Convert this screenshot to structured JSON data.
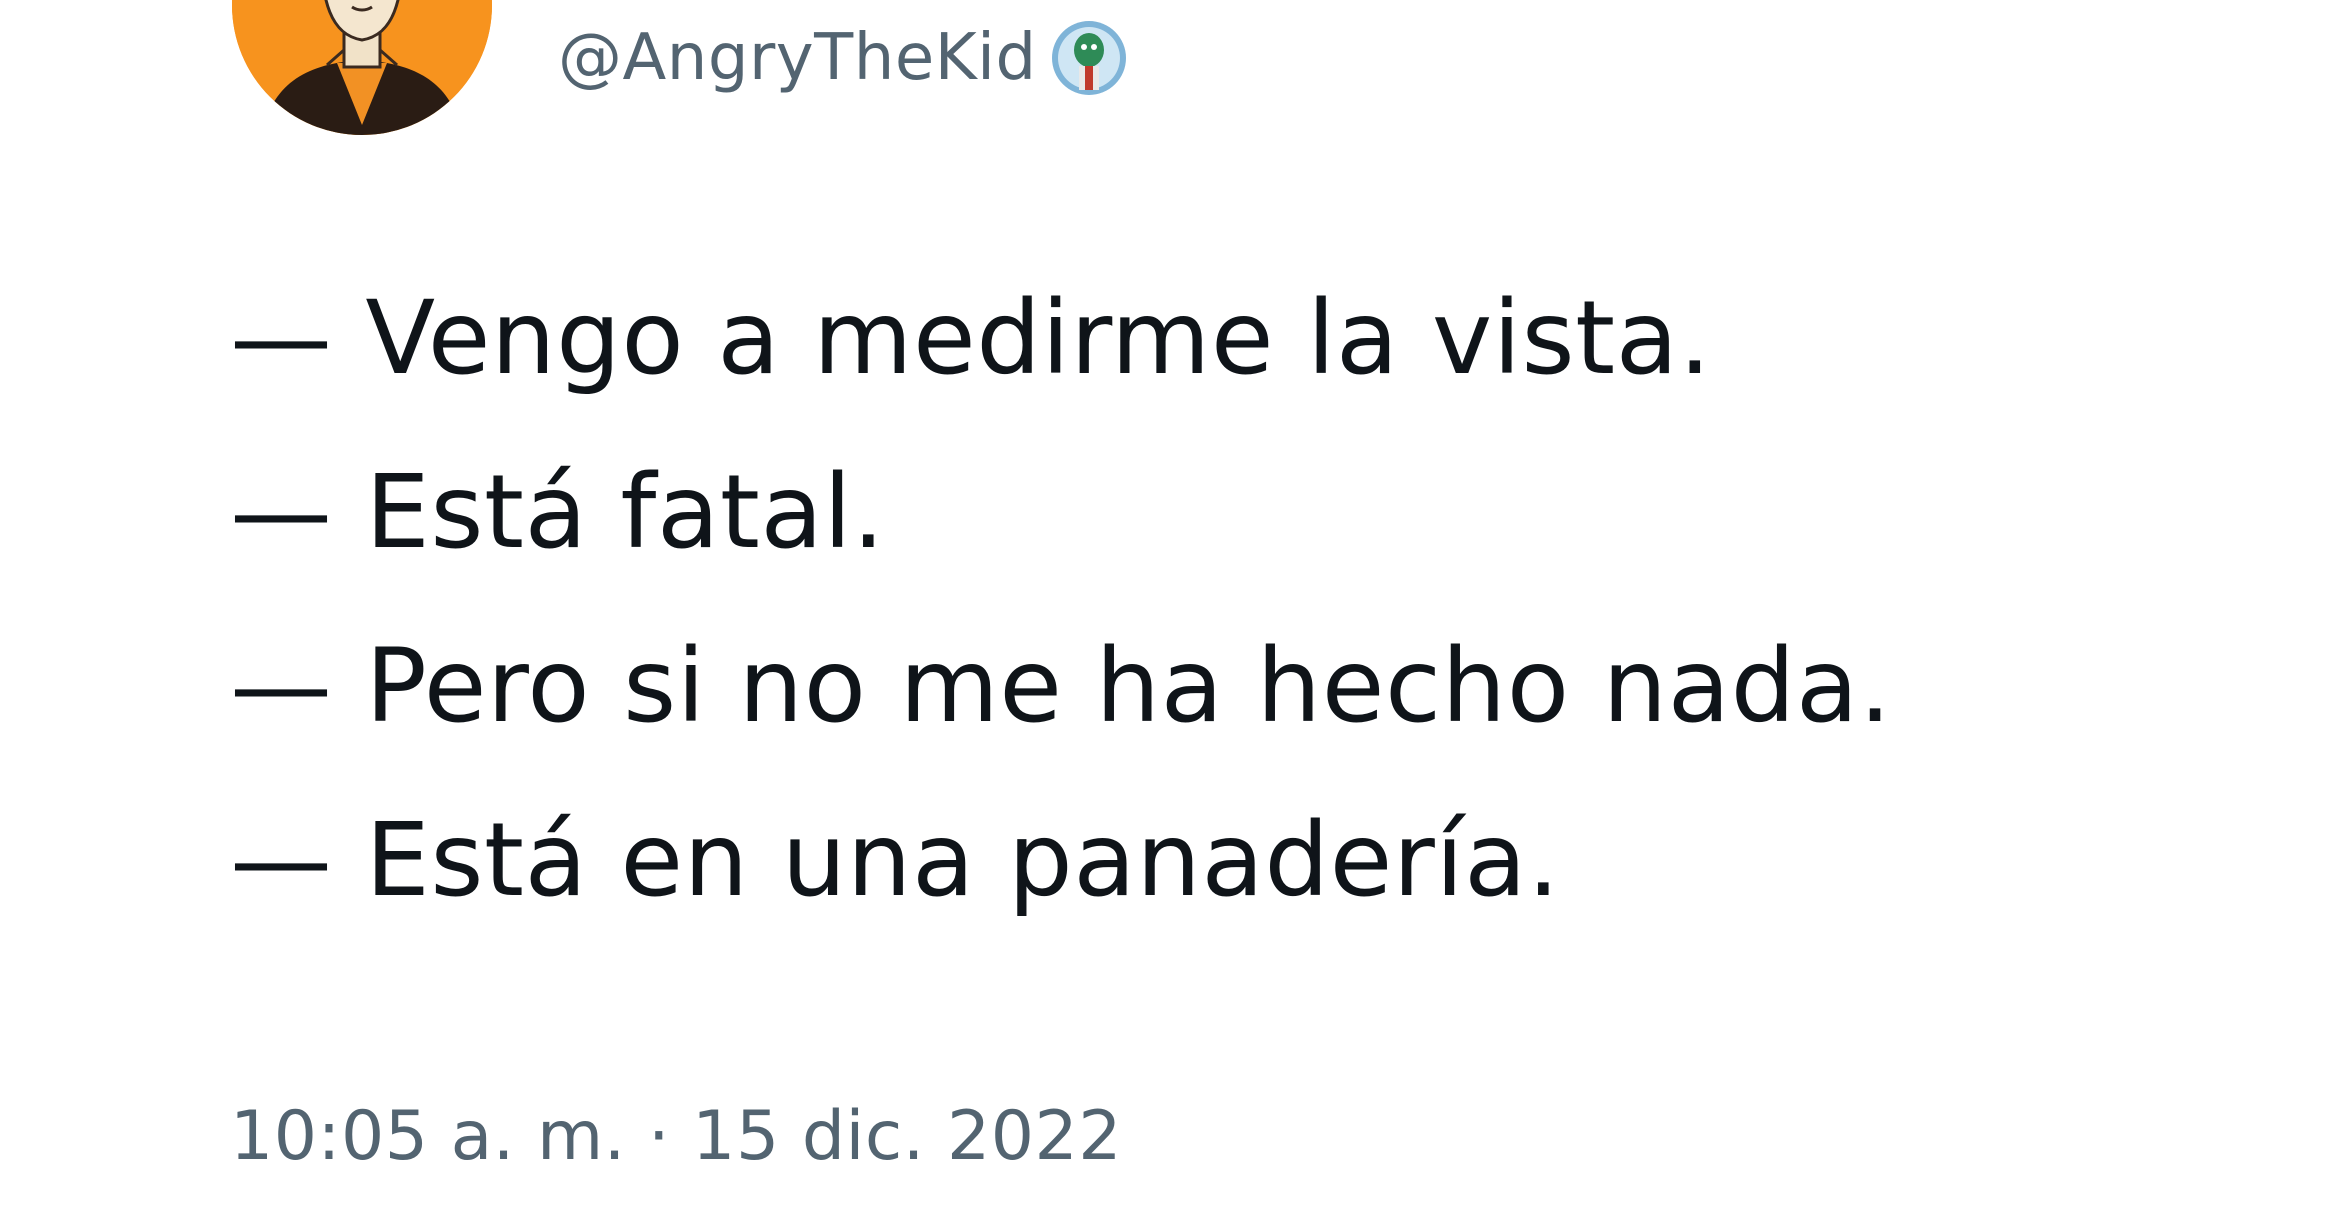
{
  "tweet": {
    "handle": "@AngryTheKid",
    "lines": [
      "— Vengo a medirme la vista.",
      "— Está fatal.",
      "— Pero si no me ha hecho nada.",
      "— Está en una panadería."
    ],
    "timestamp": "10:05 a. m. · 15 dic. 2022"
  },
  "icons": {
    "avatar": "avatar-illustration",
    "badge": "emoji-badge-icon"
  },
  "colors": {
    "avatar_bg": "#f7931e",
    "handle": "#536471",
    "text": "#0f1419"
  }
}
